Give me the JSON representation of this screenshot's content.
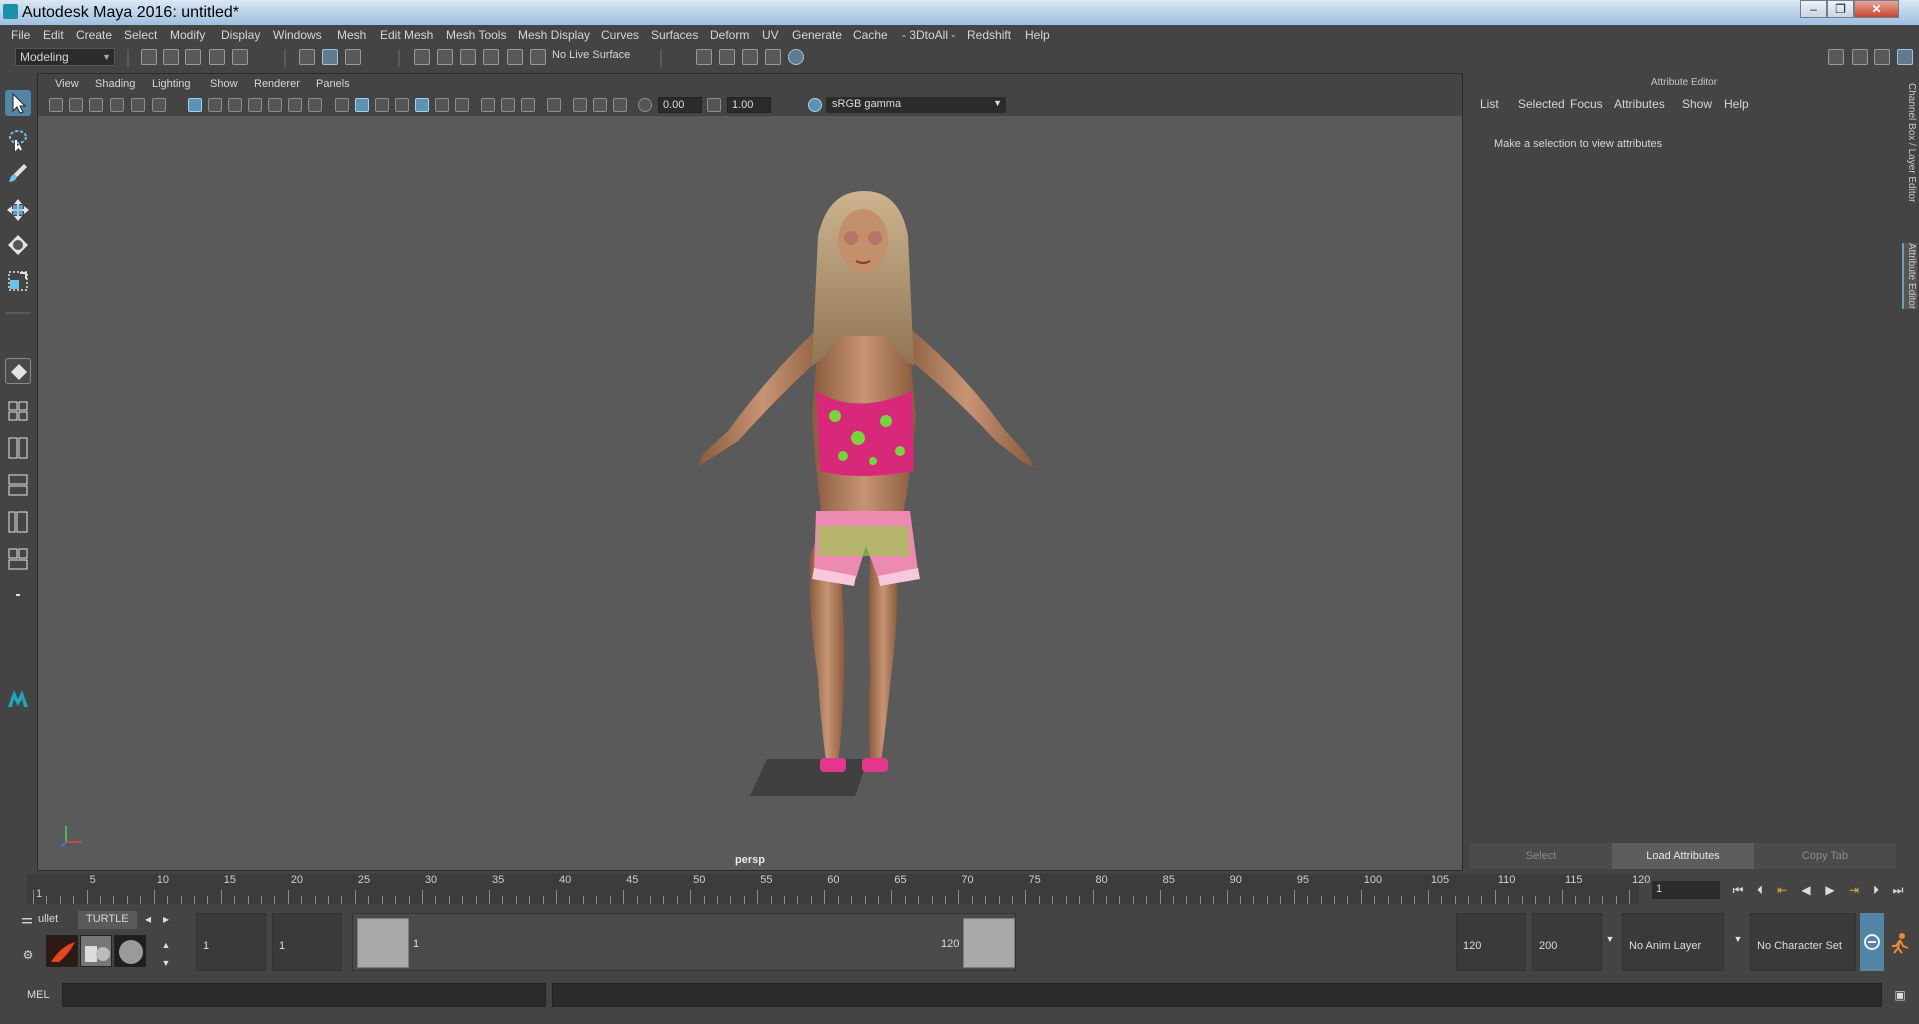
{
  "window": {
    "title": "Autodesk Maya 2016: untitled*",
    "controls": [
      "–",
      "❐",
      "✕"
    ]
  },
  "menubar": [
    "File",
    "Edit",
    "Create",
    "Select",
    "Modify",
    "Display",
    "Windows",
    "Mesh",
    "Edit Mesh",
    "Mesh Tools",
    "Mesh Display",
    "Curves",
    "Surfaces",
    "Deform",
    "UV",
    "Generate",
    "Cache",
    "- 3DtoAll -",
    "Redshift",
    "Help"
  ],
  "statusline": {
    "mode": "Modeling",
    "live_surface": "No Live Surface"
  },
  "panel": {
    "menu": [
      "View",
      "Shading",
      "Lighting",
      "Show",
      "Renderer",
      "Panels"
    ],
    "exposure": "0.00",
    "gamma": "1.00",
    "color_space": "sRGB gamma",
    "camera": "persp"
  },
  "attribute_editor": {
    "title": "Attribute Editor",
    "menu": [
      "List",
      "Selected",
      "Focus",
      "Attributes",
      "Show",
      "Help"
    ],
    "message": "Make a selection to view attributes",
    "buttons": [
      "Select",
      "Load Attributes",
      "Copy Tab"
    ],
    "side_tabs": [
      "Channel Box / Layer Editor",
      "Attribute Editor"
    ]
  },
  "timeline": {
    "ticks": [
      "1",
      "5",
      "10",
      "15",
      "20",
      "25",
      "30",
      "35",
      "40",
      "45",
      "50",
      "55",
      "60",
      "65",
      "70",
      "75",
      "80",
      "85",
      "90",
      "95",
      "100",
      "105",
      "110",
      "115",
      "120"
    ],
    "current_frame": "1"
  },
  "range": {
    "start": "1",
    "playback_start": "1",
    "range_start_label": "1",
    "range_end_label": "120",
    "playback_end": "120",
    "end": "200",
    "anim_layer": "No Anim Layer",
    "character_set": "No Character Set"
  },
  "shelf": {
    "tabs": [
      "ullet",
      "TURTLE"
    ]
  },
  "command": {
    "label": "MEL"
  }
}
